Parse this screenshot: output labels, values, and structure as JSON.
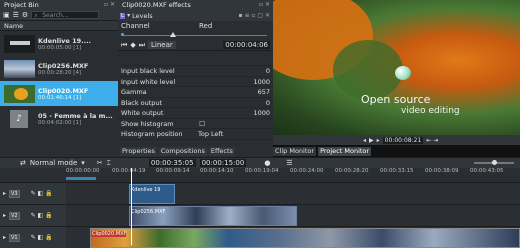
{
  "project_bin": {
    "title": "Project Bin",
    "search_placeholder": "Search...",
    "column_name": "Name",
    "clips": [
      {
        "name": "Kdenlive 19....",
        "duration": "00:00:05:00 [1]"
      },
      {
        "name": "Clip0256.MXF",
        "duration": "00:00:28:20 [4]"
      },
      {
        "name": "Clip0020.MXF",
        "duration": "00:01:46:14 [1]"
      },
      {
        "name": "05 - Femme à la m...",
        "duration": "00:04:02:00 [1]"
      }
    ]
  },
  "effects": {
    "title": "Clip0020.MXF effects",
    "effect_name": "Levels",
    "channel_label": "Channel",
    "channel_value": "Red",
    "interp": "Linear",
    "timecode": "00:00:04:06",
    "params": [
      {
        "label": "Input black level",
        "value": "0"
      },
      {
        "label": "Input white level",
        "value": "1000"
      },
      {
        "label": "Gamma",
        "value": "657"
      },
      {
        "label": "Black output",
        "value": "0"
      },
      {
        "label": "White output",
        "value": "1000"
      }
    ],
    "show_histogram": "Show histogram",
    "histogram_position_label": "Histogram position",
    "histogram_position_value": "Top Left"
  },
  "bottom_tabs": [
    "Properties",
    "Compositions",
    "Effects"
  ],
  "monitor": {
    "overlay_line1": "Open source",
    "overlay_line2": "video editing",
    "timecode": "00:00:08:21",
    "tabs": [
      "Clip Monitor",
      "Project Monitor"
    ]
  },
  "timeline": {
    "mode": "Normal mode",
    "position": "00:00:35:05",
    "end": "00:00:15:00",
    "ruler": [
      "00:00:00:00",
      "00:00:04:19",
      "00:00:09:14",
      "00:00:14:10",
      "00:00:19:04",
      "00:00:24:00",
      "00:00:28:20",
      "00:00:33:15",
      "00:00:38:09",
      "00:00:43:05"
    ],
    "tracks": [
      "V3",
      "V2",
      "V1"
    ],
    "clip_labels": [
      "Kdenlive 19",
      "Clip0256.MXF",
      "Clip0020.MXF"
    ]
  },
  "colors": {
    "accent": "#3daee9",
    "bg": "#232629",
    "panel": "#2a2e32"
  }
}
